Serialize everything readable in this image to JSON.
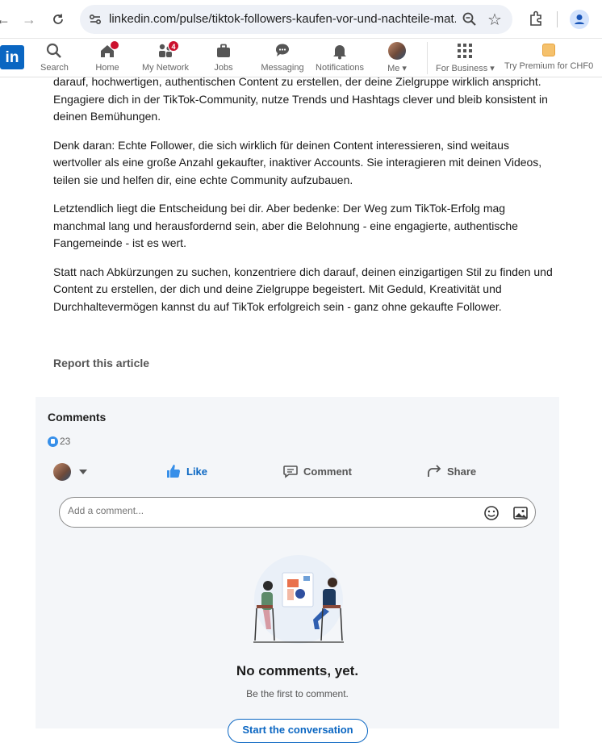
{
  "browser": {
    "url": "linkedin.com/pulse/tiktok-followers-kaufen-vor-und-nachteile-mat..."
  },
  "nav": {
    "logo": "in",
    "items": [
      {
        "label": "Search"
      },
      {
        "label": "Home"
      },
      {
        "label": "My Network",
        "badge": "4"
      },
      {
        "label": "Jobs"
      },
      {
        "label": "Messaging"
      },
      {
        "label": "Notifications"
      },
      {
        "label": "Me"
      },
      {
        "label": "For Business"
      }
    ],
    "premium": "Try Premium for CHF0"
  },
  "article": {
    "paragraphs": [
      "darauf, hochwertigen, authentischen Content zu erstellen, der deine Zielgruppe wirklich anspricht. Engagiere dich in der TikTok-Community, nutze Trends und Hashtags clever und bleib konsistent in deinen Bemühungen.",
      "Denk daran: Echte Follower, die sich wirklich für deinen Content interessieren, sind weitaus wertvoller als eine große Anzahl gekaufter, inaktiver Accounts. Sie interagieren mit deinen Videos, teilen sie und helfen dir, eine echte Community aufzubauen.",
      "Letztendlich liegt die Entscheidung bei dir. Aber bedenke: Der Weg zum TikTok-Erfolg mag manchmal lang und herausfordernd sein, aber die Belohnung - eine engagierte, authentische Fangemeinde - ist es wert.",
      "Statt nach Abkürzungen zu suchen, konzentriere dich darauf, deinen einzigartigen Stil zu finden und Content zu erstellen, der dich und deine Zielgruppe begeistert. Mit Geduld, Kreativität und Durchhaltevermögen kannst du auf TikTok erfolgreich sein - ganz ohne gekaufte Follower."
    ],
    "report": "Report this article"
  },
  "comments": {
    "title": "Comments",
    "reaction_count": "23",
    "actions": {
      "like": "Like",
      "comment": "Comment",
      "share": "Share"
    },
    "input_placeholder": "Add a comment...",
    "empty_title": "No comments, yet.",
    "empty_subtitle": "Be the first to comment.",
    "start_button": "Start the conversation"
  },
  "colors": {
    "brand": "#0a66c2",
    "notification": "#cb112d"
  }
}
